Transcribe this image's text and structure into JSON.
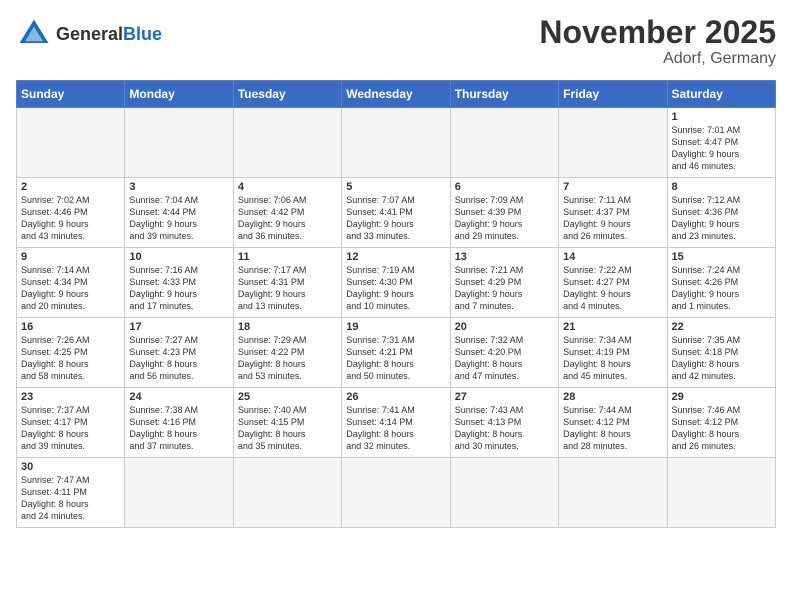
{
  "logo": {
    "text_general": "General",
    "text_blue": "Blue"
  },
  "title": {
    "month_year": "November 2025",
    "location": "Adorf, Germany"
  },
  "weekdays": [
    "Sunday",
    "Monday",
    "Tuesday",
    "Wednesday",
    "Thursday",
    "Friday",
    "Saturday"
  ],
  "days": [
    {
      "date": "",
      "empty": true
    },
    {
      "date": "",
      "empty": true
    },
    {
      "date": "",
      "empty": true
    },
    {
      "date": "",
      "empty": true
    },
    {
      "date": "",
      "empty": true
    },
    {
      "date": "",
      "empty": true
    },
    {
      "date": "1",
      "sunrise": "7:01 AM",
      "sunset": "4:47 PM",
      "daylight_h": "9",
      "daylight_m": "46"
    },
    {
      "date": "2",
      "sunrise": "7:02 AM",
      "sunset": "4:46 PM",
      "daylight_h": "9",
      "daylight_m": "43"
    },
    {
      "date": "3",
      "sunrise": "7:04 AM",
      "sunset": "4:44 PM",
      "daylight_h": "9",
      "daylight_m": "39"
    },
    {
      "date": "4",
      "sunrise": "7:06 AM",
      "sunset": "4:42 PM",
      "daylight_h": "9",
      "daylight_m": "36"
    },
    {
      "date": "5",
      "sunrise": "7:07 AM",
      "sunset": "4:41 PM",
      "daylight_h": "9",
      "daylight_m": "33"
    },
    {
      "date": "6",
      "sunrise": "7:09 AM",
      "sunset": "4:39 PM",
      "daylight_h": "9",
      "daylight_m": "29"
    },
    {
      "date": "7",
      "sunrise": "7:11 AM",
      "sunset": "4:37 PM",
      "daylight_h": "9",
      "daylight_m": "26"
    },
    {
      "date": "8",
      "sunrise": "7:12 AM",
      "sunset": "4:36 PM",
      "daylight_h": "9",
      "daylight_m": "23"
    },
    {
      "date": "9",
      "sunrise": "7:14 AM",
      "sunset": "4:34 PM",
      "daylight_h": "9",
      "daylight_m": "20"
    },
    {
      "date": "10",
      "sunrise": "7:16 AM",
      "sunset": "4:33 PM",
      "daylight_h": "9",
      "daylight_m": "17"
    },
    {
      "date": "11",
      "sunrise": "7:17 AM",
      "sunset": "4:31 PM",
      "daylight_h": "9",
      "daylight_m": "13"
    },
    {
      "date": "12",
      "sunrise": "7:19 AM",
      "sunset": "4:30 PM",
      "daylight_h": "9",
      "daylight_m": "10"
    },
    {
      "date": "13",
      "sunrise": "7:21 AM",
      "sunset": "4:29 PM",
      "daylight_h": "9",
      "daylight_m": "7"
    },
    {
      "date": "14",
      "sunrise": "7:22 AM",
      "sunset": "4:27 PM",
      "daylight_h": "9",
      "daylight_m": "4"
    },
    {
      "date": "15",
      "sunrise": "7:24 AM",
      "sunset": "4:26 PM",
      "daylight_h": "9",
      "daylight_m": "1"
    },
    {
      "date": "16",
      "sunrise": "7:26 AM",
      "sunset": "4:25 PM",
      "daylight_h": "8",
      "daylight_m": "58"
    },
    {
      "date": "17",
      "sunrise": "7:27 AM",
      "sunset": "4:23 PM",
      "daylight_h": "8",
      "daylight_m": "56"
    },
    {
      "date": "18",
      "sunrise": "7:29 AM",
      "sunset": "4:22 PM",
      "daylight_h": "8",
      "daylight_m": "53"
    },
    {
      "date": "19",
      "sunrise": "7:31 AM",
      "sunset": "4:21 PM",
      "daylight_h": "8",
      "daylight_m": "50"
    },
    {
      "date": "20",
      "sunrise": "7:32 AM",
      "sunset": "4:20 PM",
      "daylight_h": "8",
      "daylight_m": "47"
    },
    {
      "date": "21",
      "sunrise": "7:34 AM",
      "sunset": "4:19 PM",
      "daylight_h": "8",
      "daylight_m": "45"
    },
    {
      "date": "22",
      "sunrise": "7:35 AM",
      "sunset": "4:18 PM",
      "daylight_h": "8",
      "daylight_m": "42"
    },
    {
      "date": "23",
      "sunrise": "7:37 AM",
      "sunset": "4:17 PM",
      "daylight_h": "8",
      "daylight_m": "39"
    },
    {
      "date": "24",
      "sunrise": "7:38 AM",
      "sunset": "4:16 PM",
      "daylight_h": "8",
      "daylight_m": "37"
    },
    {
      "date": "25",
      "sunrise": "7:40 AM",
      "sunset": "4:15 PM",
      "daylight_h": "8",
      "daylight_m": "35"
    },
    {
      "date": "26",
      "sunrise": "7:41 AM",
      "sunset": "4:14 PM",
      "daylight_h": "8",
      "daylight_m": "32"
    },
    {
      "date": "27",
      "sunrise": "7:43 AM",
      "sunset": "4:13 PM",
      "daylight_h": "8",
      "daylight_m": "30"
    },
    {
      "date": "28",
      "sunrise": "7:44 AM",
      "sunset": "4:12 PM",
      "daylight_h": "8",
      "daylight_m": "28"
    },
    {
      "date": "29",
      "sunrise": "7:46 AM",
      "sunset": "4:12 PM",
      "daylight_h": "8",
      "daylight_m": "26"
    },
    {
      "date": "30",
      "sunrise": "7:47 AM",
      "sunset": "4:11 PM",
      "daylight_h": "8",
      "daylight_m": "24"
    },
    {
      "date": "",
      "empty": true
    },
    {
      "date": "",
      "empty": true
    },
    {
      "date": "",
      "empty": true
    },
    {
      "date": "",
      "empty": true
    },
    {
      "date": "",
      "empty": true
    },
    {
      "date": "",
      "empty": true
    }
  ]
}
